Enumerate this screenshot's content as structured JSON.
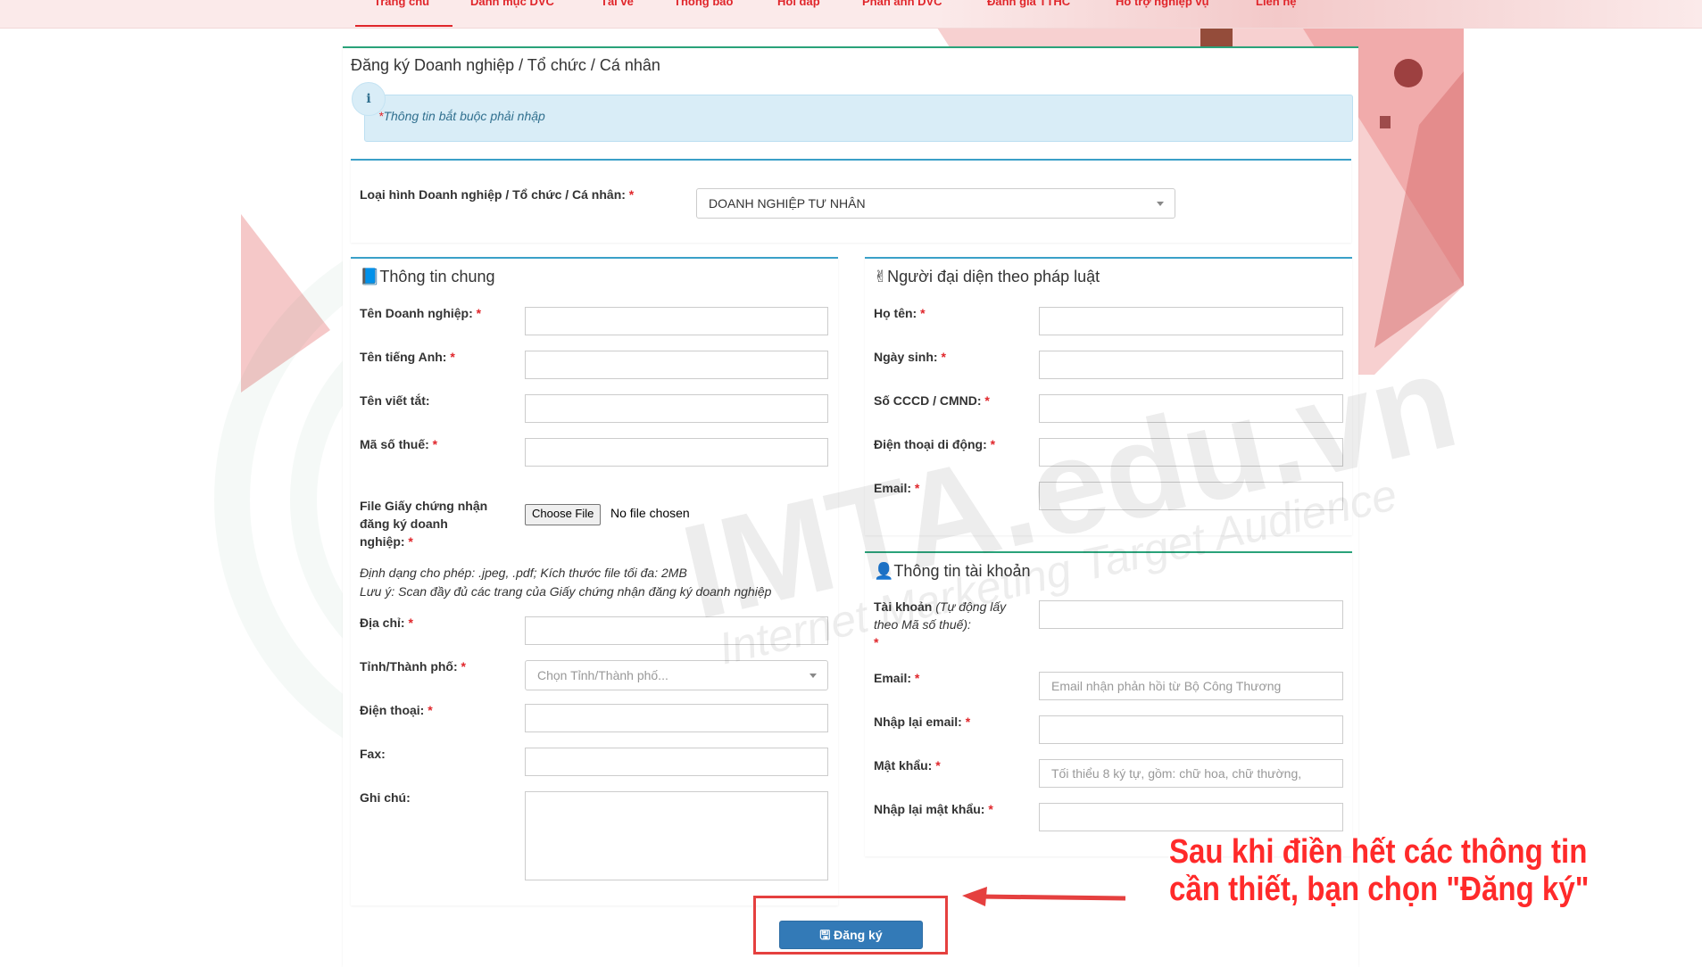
{
  "nav": {
    "items": [
      "Trang chủ",
      "Danh mục DVC",
      "Tải về",
      "Thông báo",
      "Hỏi đáp",
      "Phản ánh DVC",
      "Đánh giá TTHC",
      "Hỗ trợ nghiệp vụ",
      "Liên hệ"
    ],
    "active": "Trang chủ"
  },
  "page": {
    "title": "Đăng ký Doanh nghiệp / Tổ chức / Cá nhân",
    "info_text": "Thông tin bắt buộc phải nhập",
    "required_mark": "*"
  },
  "type_select": {
    "label": "Loại hình Doanh nghiệp / Tổ chức / Cá nhân:",
    "value": "DOANH NGHIỆP TƯ NHÂN"
  },
  "general": {
    "title": "Thông tin chung",
    "company_name": "Tên Doanh nghiệp:",
    "english_name": "Tên tiếng Anh:",
    "short_name": "Tên viết tắt:",
    "tax_code": "Mã số thuế:",
    "file_label": "File Giấy chứng nhận đăng ký doanh nghiệp:",
    "file_button": "Choose File",
    "file_status": "No file chosen",
    "note_format": "Định dạng cho phép: .jpeg, .pdf; Kích thước file tối đa: 2MB",
    "note_scan": "Lưu ý: Scan đầy đủ các trang của Giấy chứng nhận đăng ký doanh nghiệp",
    "address": "Địa chỉ:",
    "province": "Tỉnh/Thành phố:",
    "province_placeholder": "Chọn Tỉnh/Thành phố...",
    "phone": "Điện thoại:",
    "fax": "Fax:",
    "notes": "Ghi chú:"
  },
  "representative": {
    "title": "Người đại diện theo pháp luật",
    "full_name": "Họ tên:",
    "birth_date": "Ngày sinh:",
    "id_number": "Số CCCD / CMND:",
    "mobile": "Điện thoại di động:",
    "email": "Email:"
  },
  "account": {
    "title": "Thông tin tài khoản",
    "username_label": "Tài khoản",
    "username_hint": "(Tự động lấy theo Mã số thuế):",
    "email": "Email:",
    "email_placeholder": "Email nhận phản hồi từ Bộ Công Thương",
    "email_confirm": "Nhập lại email:",
    "password": "Mật khẩu:",
    "password_placeholder": "Tối thiểu 8 ký tự, gồm: chữ hoa, chữ thường,",
    "password_confirm": "Nhập lại mật khẩu:"
  },
  "submit": {
    "label": "Đăng ký"
  },
  "annotation": {
    "line1": "Sau khi điền hết các thông tin",
    "line2": "cần thiết, bạn chọn \"Đăng ký\""
  },
  "watermark": {
    "main": "IMTA.edu.vn",
    "sub": "Internet Marketing Target Audience"
  },
  "colors": {
    "accent_red": "#e0262b",
    "panel_green": "#2aa37a",
    "panel_blue": "#3aa0c8",
    "button_blue": "#337ab7",
    "info_bg": "#d9edf7"
  }
}
